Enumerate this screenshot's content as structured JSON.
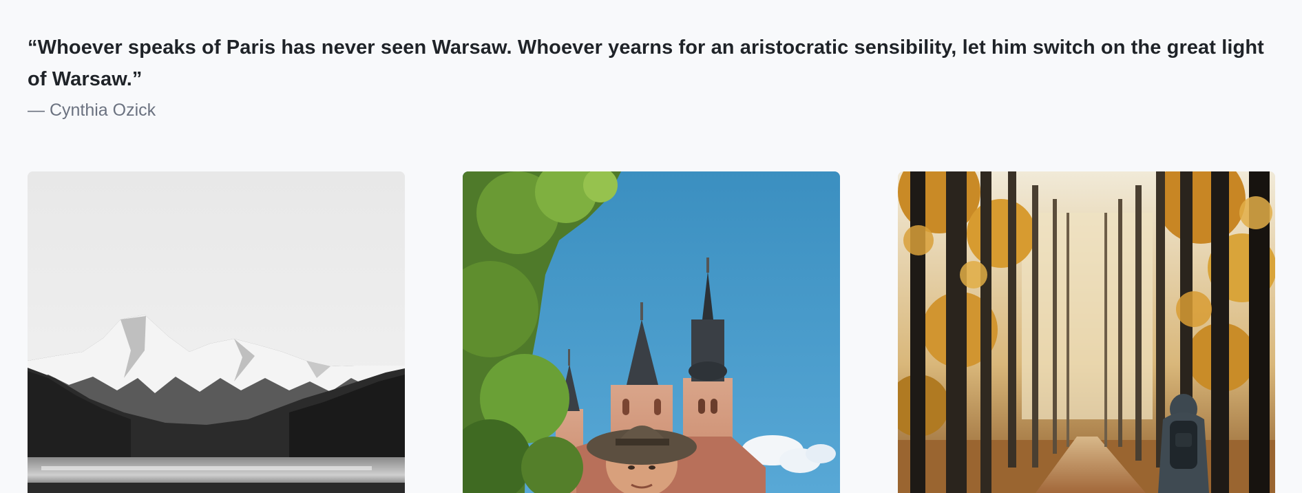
{
  "quote": {
    "text": "“Whoever speaks of Paris has never seen Warsaw. Whoever yearns for an aristocratic sensibility, let him switch on the great light of Warsaw.”",
    "author": "— Cynthia Ozick"
  },
  "gallery": {
    "images": [
      {
        "subject": "black-and-white snowy mountain range over a lake"
      },
      {
        "subject": "man in a fedora in front of a gothic church under blue sky"
      },
      {
        "subject": "hiker with backpack walking down an autumn forest path"
      }
    ]
  },
  "colors": {
    "page_background": "#f8f9fb",
    "quote_text": "#1f2328",
    "author_text": "#6b7280",
    "sky_blue": "#3f95c6",
    "autumn_gold": "#d39a3a"
  }
}
